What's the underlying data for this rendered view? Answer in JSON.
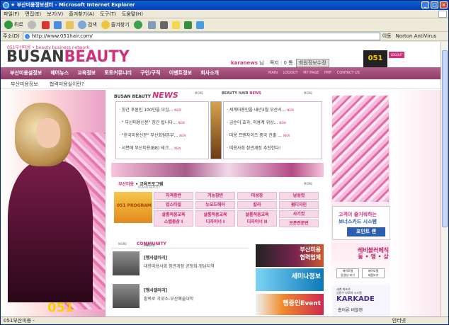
{
  "window": {
    "title": "★ 부산미용정보센터 - Microsoft Internet Explorer"
  },
  "menu": [
    "파일(F)",
    "편집(E)",
    "보기(V)",
    "즐겨찾기(A)",
    "도구(T)",
    "도움말(H)"
  ],
  "toolbar": {
    "back": "뒤로",
    "search": "검색",
    "favorites": "즐겨찾기"
  },
  "address": {
    "label": "주소(D)",
    "url": "http://www.051hair.com/",
    "go": "이동",
    "extra": "Norton AntiVirus"
  },
  "page": {
    "brand_small": "051부산미용 • beauty business network",
    "brand_main": "BUSAN",
    "brand_accent": "BEAUTY",
    "user": {
      "name": "karanews",
      "suffix": " 님",
      "points_label": "쪽지 : 0 통",
      "edit_btn": "회원정보수정"
    },
    "badge": "051",
    "login": "LOGOUT",
    "nav": [
      "부산미용설정보",
      "헤어뉴스",
      "교육정보",
      "토토커뮤니티",
      "구인/구직",
      "이벤트정보",
      "회사소개"
    ],
    "subnav": [
      "MAIN",
      "LOGOUT",
      "MY PAGE",
      "PMP",
      "CONTACT US"
    ],
    "crumbs": [
      "부산미용정보",
      "협력미용실이란?"
    ],
    "news": {
      "logo": "BUSAN BEAUTY",
      "logo_accent": "NEWS",
      "more": "MORE",
      "hair_logo": "BEAUTY HAIR",
      "hair_accent": "NEWS",
      "hair_more": "MORE",
      "left": [
        "· 창간 후원인 100인을 모십...",
        "· \" 부산미용신문\" 창간 됩니다...",
        "· \"한국미용신문\" 부산회원본부...",
        "· 서면에 부산미용(BB) 테크..."
      ],
      "right": [
        "· 세계미용인을 내년3월 부산서...",
        "· 금순이 효과, 미용계 위상...",
        "· 미용 프랜차이즈 중국 진출 ...",
        "· 미용사회 정관개정 추진한다!"
      ],
      "new_tag": "NEW"
    },
    "program": {
      "title": "부산미용",
      "title_accent": " • 교육프로그램",
      "sub": "BUSAN BEAUTY",
      "more": "MORE",
      "pic_label": "051 PROGRAM",
      "cells": [
        "자격증반",
        "기능장반",
        "미성장",
        "남성컷",
        "업스타일",
        "뉴모드헤어",
        "칼라",
        "펌디자인",
        "살롱적응교육\n스텝총상 I",
        "살롱적응교육\n디자이너 I",
        "살롱적응교육\n디자이너 II",
        "사기컷",
        "",
        "",
        "",
        "오픈전문반"
      ]
    },
    "community": {
      "more": "MORE",
      "title": "PHOTO",
      "title_accent": " COMMUNITY",
      "items": [
        {
          "title": "[행사갤러리]",
          "text": "대한미용사회 정관개정 공청회-영남지역"
        },
        {
          "title": "[행사갤러리]",
          "text": "황복로 가위소-부산예술대학"
        }
      ]
    },
    "banners": [
      "부산미용\n협력업체",
      "세미나정보",
      "행중인Event"
    ],
    "ads": {
      "ad1_a": "고객이 즐거워하는",
      "ad1_b": "보너스카드 시스템",
      "ad1_c": "포인트 랜",
      "ad2_a": "레비블러메직\n동 • 앵 • 상",
      "ad2_b": "헤어모델\n동영상 보기",
      "ad2_c": "헤어모델\n제품보기",
      "ad3_a": "세계 최초의\n공용수 아로마 시스템",
      "ad3_b": "KARKADE",
      "ad3_c": "흡어론 버블캔"
    },
    "model_num": "051"
  },
  "status": {
    "text": "051부산미용 -",
    "zone": "인터넷"
  }
}
